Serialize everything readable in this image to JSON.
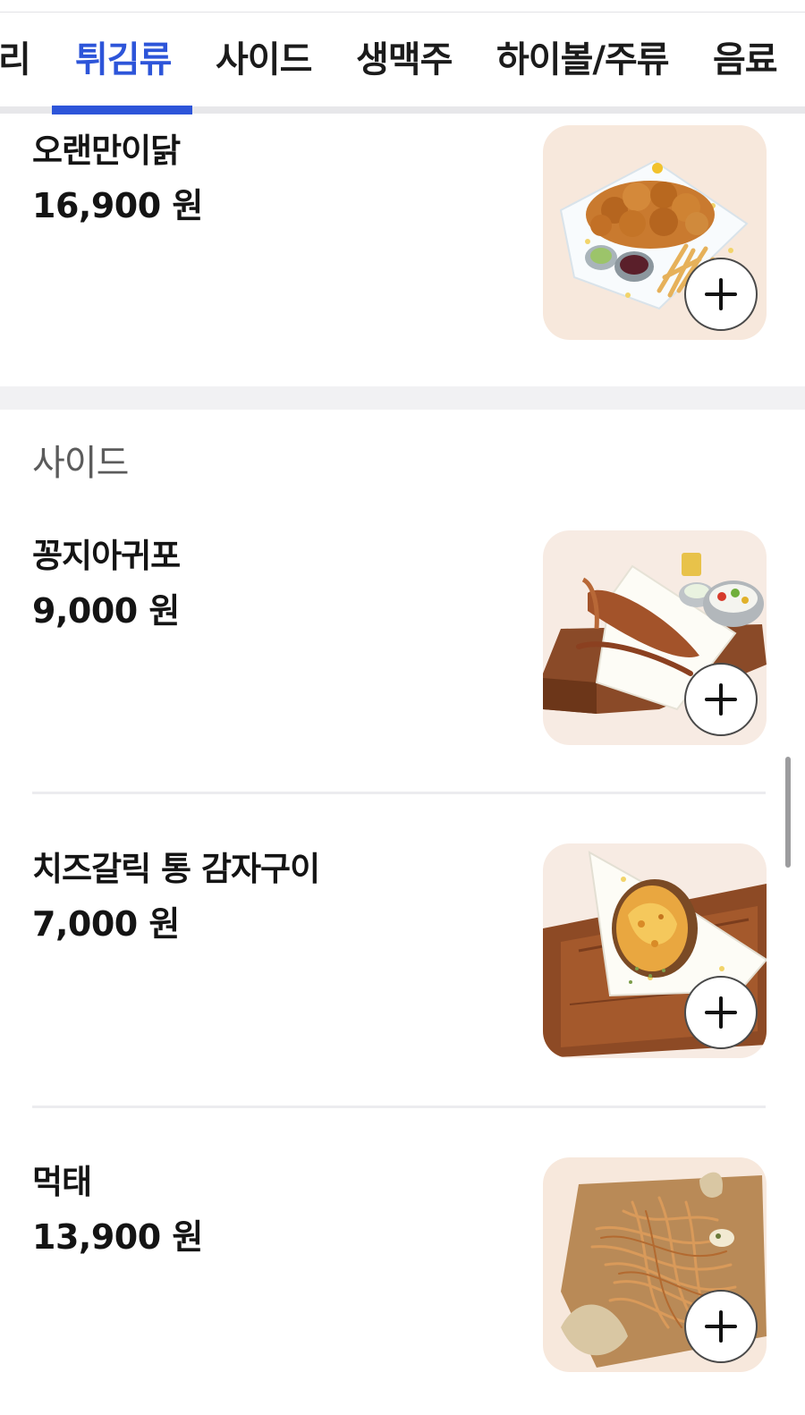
{
  "tabs": [
    {
      "label": "리",
      "active": false
    },
    {
      "label": "튀김류",
      "active": true
    },
    {
      "label": "사이드",
      "active": false
    },
    {
      "label": "생맥주",
      "active": false
    },
    {
      "label": "하이볼/주류",
      "active": false
    },
    {
      "label": "음료",
      "active": false
    }
  ],
  "colors": {
    "accent": "#2d55d9",
    "text": "#141414",
    "muted": "#5b5b5b",
    "divider": "#ececef"
  },
  "sections": [
    {
      "title": "",
      "items": [
        {
          "name": "오랜만이닭",
          "price": "16,900 원",
          "image": "fried-chicken-platter-photo",
          "add_icon": "plus-icon"
        }
      ]
    },
    {
      "title": "사이드",
      "items": [
        {
          "name": "꽁지아귀포",
          "price": "9,000 원",
          "image": "dried-monkfish-board-photo",
          "add_icon": "plus-icon"
        },
        {
          "name": "치즈갈릭 통 감자구이",
          "price": "7,000 원",
          "image": "baked-potato-board-photo",
          "add_icon": "plus-icon"
        },
        {
          "name": "먹태",
          "price": "13,900 원",
          "image": "dried-pollack-photo",
          "add_icon": "plus-icon"
        }
      ]
    }
  ]
}
